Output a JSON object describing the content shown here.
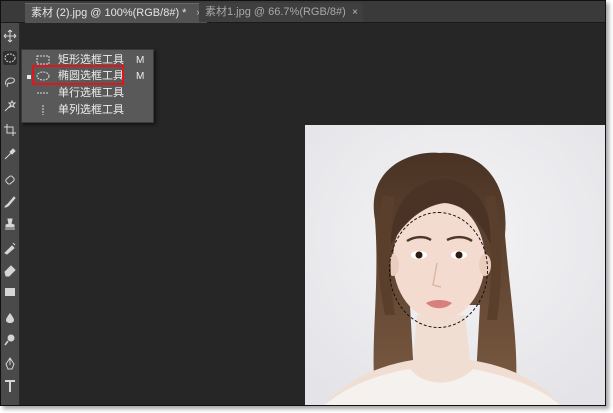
{
  "tabs": [
    {
      "label": "素材 (2).jpg @ 100%(RGB/8#) *",
      "close": "×"
    },
    {
      "label": "素材1.jpg @ 66.7%(RGB/8#)",
      "close": "×"
    }
  ],
  "flyout": {
    "items": [
      {
        "label": "矩形选框工具",
        "shortcut": "M",
        "icon": "rect-marquee-icon"
      },
      {
        "label": "椭圆选框工具",
        "shortcut": "M",
        "icon": "ellipse-marquee-icon",
        "active": true
      },
      {
        "label": "单行选框工具",
        "shortcut": "",
        "icon": "single-row-marquee-icon"
      },
      {
        "label": "单列选框工具",
        "shortcut": "",
        "icon": "single-column-marquee-icon"
      }
    ]
  },
  "toolbar_icons": [
    "move-icon",
    "marquee-icon",
    "lasso-icon",
    "quick-select-icon",
    "crop-icon",
    "eyedropper-icon",
    "healing-icon",
    "brush-icon",
    "clone-stamp-icon",
    "history-brush-icon",
    "eraser-icon",
    "gradient-icon",
    "blur-icon",
    "dodge-icon",
    "pen-icon",
    "type-icon"
  ],
  "colors": {
    "highlight": "#e0161b",
    "panel": "#595959",
    "background": "#262626"
  }
}
